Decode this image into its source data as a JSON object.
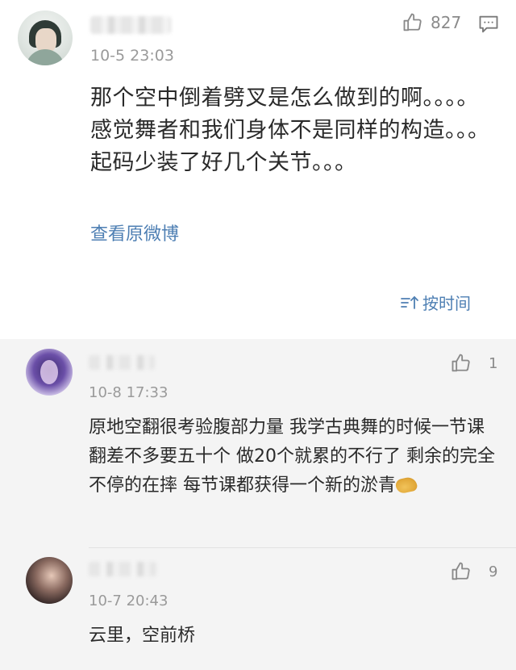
{
  "main_post": {
    "timestamp": "10-5 23:03",
    "like_count": "827",
    "text": "那个空中倒着劈叉是怎么做到的啊。。。。感觉舞者和我们身体不是同样的构造。。。起码少装了好几个关节。。。",
    "view_original_label": "查看原微博"
  },
  "sort": {
    "label": "按时间"
  },
  "comments": [
    {
      "timestamp": "10-8 17:33",
      "like_count": "1",
      "text": "原地空翻很考验腹部力量 我学古典舞的时候一节课翻差不多要五十个 做20个就累的不行了 剩余的完全不停的在摔 每节课都获得一个新的淤青"
    },
    {
      "timestamp": "10-7 20:43",
      "like_count": "9",
      "text": "云里，空前桥"
    }
  ],
  "colors": {
    "link_blue": "#4e7fb3",
    "comments_bg": "#f4f4f4",
    "meta_gray": "#9a9a9a"
  },
  "icons": {
    "like": "thumbs-up-icon",
    "comment": "comment-bubble-icon",
    "sort": "sort-time-icon",
    "emoji": "pinched-hands-emoji-icon"
  }
}
